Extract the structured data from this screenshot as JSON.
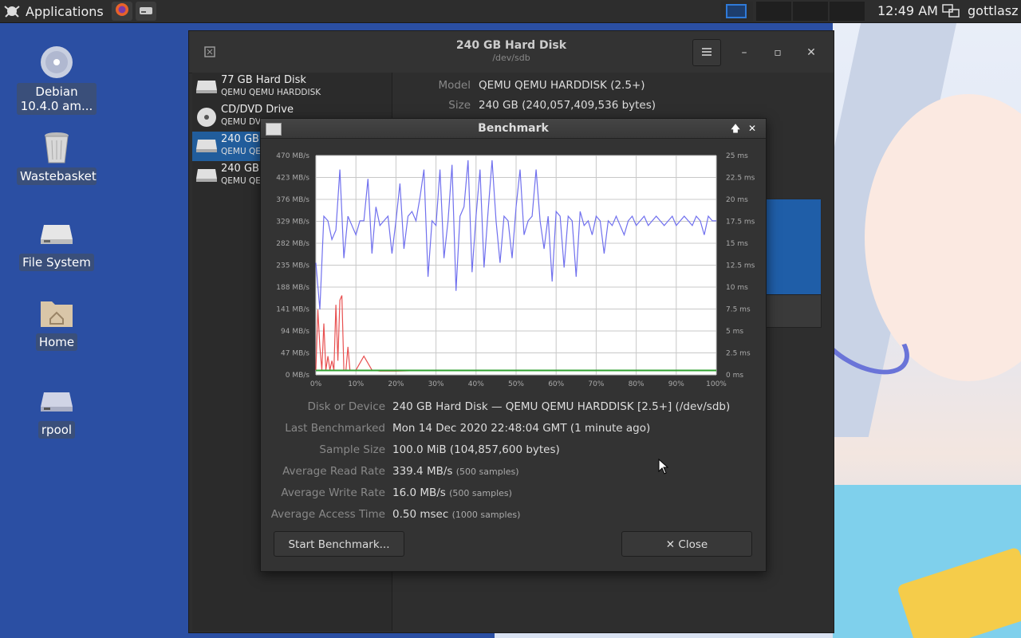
{
  "panel": {
    "applications_label": "Applications",
    "clock": "12:49 AM",
    "user": "gottlasz"
  },
  "desktop": {
    "icons": [
      {
        "label": "Debian 10.4.0 am..."
      },
      {
        "label": "Wastebasket"
      },
      {
        "label": "File System"
      },
      {
        "label": "Home"
      },
      {
        "label": "rpool"
      }
    ]
  },
  "main_window": {
    "title": "240 GB Hard Disk",
    "subtitle": "/dev/sdb",
    "devices": [
      {
        "name": "77 GB Hard Disk",
        "sub": "QEMU QEMU HARDDISK"
      },
      {
        "name": "CD/DVD Drive",
        "sub": "QEMU DV"
      },
      {
        "name": "240 GB",
        "sub": "QEMU QE"
      },
      {
        "name": "240 GB",
        "sub": "QEMU QE"
      }
    ],
    "model_label": "Model",
    "model_value": "QEMU QEMU HARDDISK (2.5+)",
    "size_label": "Size",
    "size_value": "240 GB (240,057,409,536 bytes)"
  },
  "benchmark": {
    "title": "Benchmark",
    "fields": [
      {
        "key": "Disk or Device",
        "value": "240 GB Hard Disk — QEMU QEMU HARDDISK [2.5+] (/dev/sdb)",
        "extra": ""
      },
      {
        "key": "Last Benchmarked",
        "value": "Mon 14 Dec 2020 22:48:04 GMT (1 minute ago)",
        "extra": ""
      },
      {
        "key": "Sample Size",
        "value": "100.0 MiB (104,857,600 bytes)",
        "extra": ""
      },
      {
        "key": "Average Read Rate",
        "value": "339.4 MB/s",
        "extra": "(500 samples)"
      },
      {
        "key": "Average Write Rate",
        "value": "16.0 MB/s",
        "extra": "(500 samples)"
      },
      {
        "key": "Average Access Time",
        "value": "0.50 msec",
        "extra": "(1000 samples)"
      }
    ],
    "start_button": "Start Benchmark...",
    "close_button": "✕ Close"
  },
  "chart_data": {
    "type": "line",
    "x_tick_labels": [
      "0%",
      "10%",
      "20%",
      "30%",
      "40%",
      "50%",
      "60%",
      "70%",
      "80%",
      "90%",
      "100%"
    ],
    "y_left_tick_labels": [
      "0 MB/s",
      "47 MB/s",
      "94 MB/s",
      "141 MB/s",
      "188 MB/s",
      "235 MB/s",
      "282 MB/s",
      "329 MB/s",
      "376 MB/s",
      "423 MB/s",
      "470 MB/s"
    ],
    "y_right_tick_labels": [
      "0 ms",
      "2.5 ms",
      "5 ms",
      "7.5 ms",
      "10 ms",
      "12.5 ms",
      "15 ms",
      "17.5 ms",
      "20 ms",
      "22.5 ms",
      "25 ms"
    ],
    "ylim_left": [
      0,
      470
    ],
    "ylim_right": [
      0,
      25
    ],
    "grid": true,
    "colors": {
      "read": "#7070ee",
      "write": "#e85050",
      "access": "#30a030"
    },
    "series": [
      {
        "key": "read",
        "x": [
          0,
          1,
          2,
          3,
          4,
          5,
          6,
          7,
          8,
          9,
          10,
          11,
          12,
          13,
          14,
          15,
          16,
          17,
          18,
          19,
          20,
          21,
          22,
          23,
          24,
          25,
          26,
          27,
          28,
          29,
          30,
          31,
          32,
          33,
          34,
          35,
          36,
          37,
          38,
          39,
          40,
          41,
          42,
          43,
          44,
          45,
          46,
          47,
          48,
          49,
          50,
          51,
          52,
          53,
          54,
          55,
          56,
          57,
          58,
          59,
          60,
          61,
          62,
          63,
          64,
          65,
          66,
          67,
          68,
          69,
          70,
          71,
          72,
          73,
          74,
          75,
          76,
          77,
          78,
          79,
          80,
          81,
          82,
          83,
          84,
          85,
          86,
          87,
          88,
          89,
          90,
          91,
          92,
          93,
          94,
          95,
          96,
          97,
          98,
          99,
          100
        ],
        "values": [
          240,
          140,
          340,
          330,
          290,
          310,
          440,
          250,
          340,
          320,
          300,
          330,
          330,
          420,
          260,
          360,
          320,
          330,
          340,
          260,
          330,
          410,
          270,
          340,
          350,
          330,
          380,
          440,
          210,
          330,
          320,
          440,
          250,
          330,
          450,
          180,
          340,
          360,
          460,
          220,
          340,
          440,
          230,
          350,
          460,
          330,
          240,
          340,
          330,
          250,
          360,
          440,
          300,
          330,
          340,
          440,
          330,
          270,
          340,
          200,
          350,
          340,
          230,
          340,
          330,
          210,
          350,
          320,
          330,
          300,
          340,
          330,
          260,
          330,
          320,
          340,
          320,
          300,
          330,
          340,
          320,
          330,
          340,
          320,
          330,
          340,
          330,
          320,
          330,
          340,
          320,
          330,
          340,
          330,
          320,
          340,
          330,
          300,
          340,
          330,
          330
        ]
      },
      {
        "key": "write",
        "x": [
          0,
          0.5,
          1,
          1.5,
          2,
          2.5,
          3,
          3.5,
          4,
          4.5,
          5,
          5.5,
          6,
          6.5,
          7,
          7.5,
          8,
          8.5,
          9,
          10,
          12,
          14,
          16,
          18,
          20,
          30,
          40,
          50,
          60,
          70,
          80,
          90,
          100
        ],
        "values": [
          10,
          140,
          60,
          10,
          110,
          10,
          40,
          10,
          30,
          10,
          150,
          30,
          160,
          170,
          10,
          10,
          60,
          10,
          10,
          10,
          40,
          10,
          8,
          8,
          8,
          10,
          10,
          10,
          10,
          10,
          10,
          10,
          10
        ]
      },
      {
        "key": "access",
        "x": [
          0,
          10,
          20,
          30,
          40,
          50,
          60,
          70,
          80,
          90,
          100
        ],
        "values": [
          0.5,
          0.5,
          0.5,
          0.5,
          0.5,
          0.5,
          0.5,
          0.5,
          0.5,
          0.5,
          0.5
        ]
      }
    ]
  }
}
